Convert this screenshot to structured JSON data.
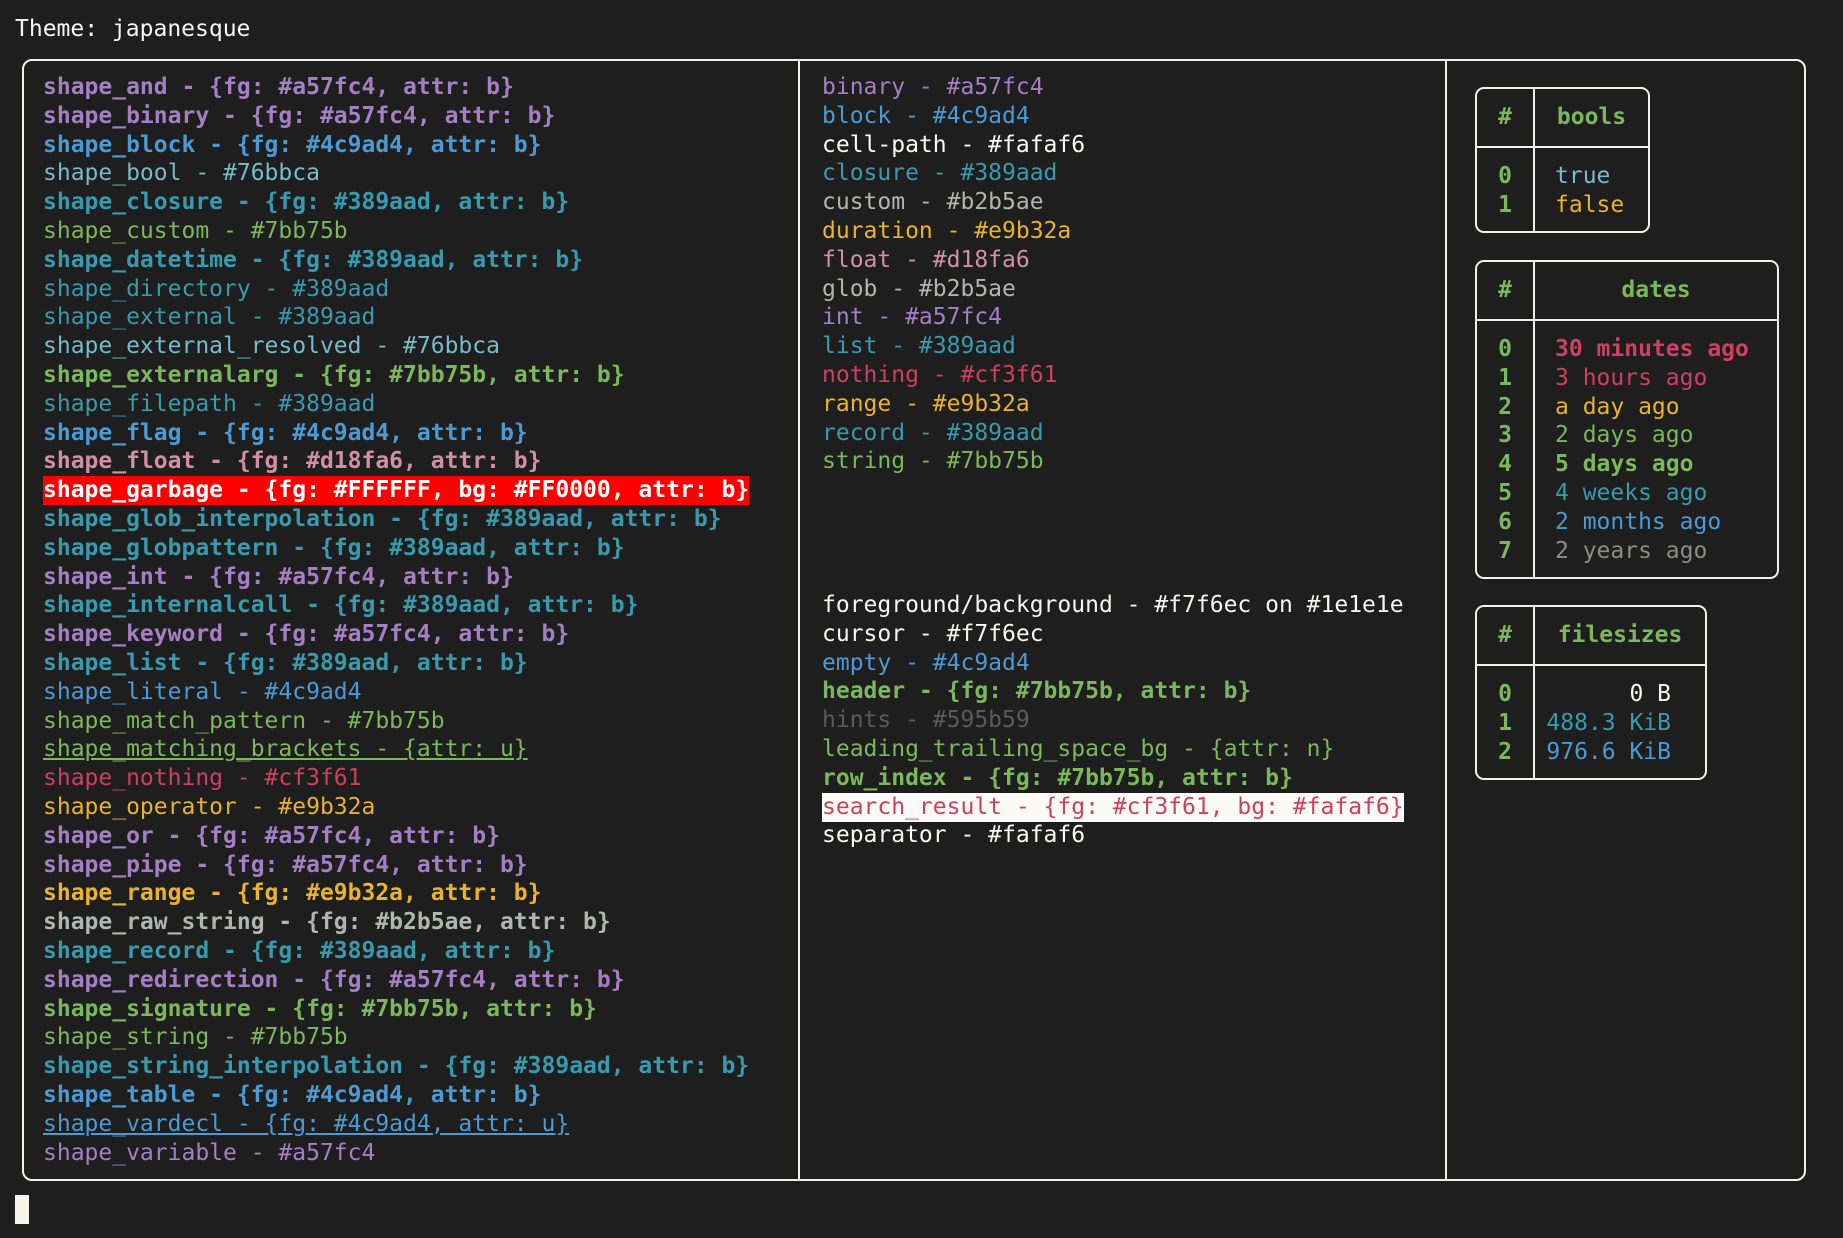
{
  "title": "Theme: japanesque",
  "left_column": [
    {
      "text": "shape_and - {fg: #a57fc4, attr: b}",
      "fg": "#a57fc4",
      "bold": true
    },
    {
      "text": "shape_binary - {fg: #a57fc4, attr: b}",
      "fg": "#a57fc4",
      "bold": true
    },
    {
      "text": "shape_block - {fg: #4c9ad4, attr: b}",
      "fg": "#4c9ad4",
      "bold": true
    },
    {
      "text": "shape_bool - #76bbca",
      "fg": "#76bbca"
    },
    {
      "text": "shape_closure - {fg: #389aad, attr: b}",
      "fg": "#389aad",
      "bold": true
    },
    {
      "text": "shape_custom - #7bb75b",
      "fg": "#7bb75b"
    },
    {
      "text": "shape_datetime - {fg: #389aad, attr: b}",
      "fg": "#389aad",
      "bold": true
    },
    {
      "text": "shape_directory - #389aad",
      "fg": "#389aad"
    },
    {
      "text": "shape_external - #389aad",
      "fg": "#389aad"
    },
    {
      "text": "shape_external_resolved - #76bbca",
      "fg": "#76bbca"
    },
    {
      "text": "shape_externalarg - {fg: #7bb75b, attr: b}",
      "fg": "#7bb75b",
      "bold": true
    },
    {
      "text": "shape_filepath - #389aad",
      "fg": "#389aad"
    },
    {
      "text": "shape_flag - {fg: #4c9ad4, attr: b}",
      "fg": "#4c9ad4",
      "bold": true
    },
    {
      "text": "shape_float - {fg: #d18fa6, attr: b}",
      "fg": "#d18fa6",
      "bold": true
    },
    {
      "text": "shape_garbage - {fg: #FFFFFF, bg: #FF0000, attr: b}",
      "fg": "#FFFFFF",
      "bg": "#FF0000",
      "bold": true
    },
    {
      "text": "shape_glob_interpolation - {fg: #389aad, attr: b}",
      "fg": "#389aad",
      "bold": true
    },
    {
      "text": "shape_globpattern - {fg: #389aad, attr: b}",
      "fg": "#389aad",
      "bold": true
    },
    {
      "text": "shape_int - {fg: #a57fc4, attr: b}",
      "fg": "#a57fc4",
      "bold": true
    },
    {
      "text": "shape_internalcall - {fg: #389aad, attr: b}",
      "fg": "#389aad",
      "bold": true
    },
    {
      "text": "shape_keyword - {fg: #a57fc4, attr: b}",
      "fg": "#a57fc4",
      "bold": true
    },
    {
      "text": "shape_list - {fg: #389aad, attr: b}",
      "fg": "#389aad",
      "bold": true
    },
    {
      "text": "shape_literal - #4c9ad4",
      "fg": "#4c9ad4"
    },
    {
      "text": "shape_match_pattern - #7bb75b",
      "fg": "#7bb75b"
    },
    {
      "text": "shape_matching_brackets - {attr: u}",
      "fg": "#7bb75b",
      "underline": true
    },
    {
      "text": "shape_nothing - #cf3f61",
      "fg": "#cf3f61"
    },
    {
      "text": "shape_operator - #e9b32a",
      "fg": "#e9b32a"
    },
    {
      "text": "shape_or - {fg: #a57fc4, attr: b}",
      "fg": "#a57fc4",
      "bold": true
    },
    {
      "text": "shape_pipe - {fg: #a57fc4, attr: b}",
      "fg": "#a57fc4",
      "bold": true
    },
    {
      "text": "shape_range - {fg: #e9b32a, attr: b}",
      "fg": "#e9b32a",
      "bold": true
    },
    {
      "text": "shape_raw_string - {fg: #b2b5ae, attr: b}",
      "fg": "#b2b5ae",
      "bold": true
    },
    {
      "text": "shape_record - {fg: #389aad, attr: b}",
      "fg": "#389aad",
      "bold": true
    },
    {
      "text": "shape_redirection - {fg: #a57fc4, attr: b}",
      "fg": "#a57fc4",
      "bold": true
    },
    {
      "text": "shape_signature - {fg: #7bb75b, attr: b}",
      "fg": "#7bb75b",
      "bold": true
    },
    {
      "text": "shape_string - #7bb75b",
      "fg": "#7bb75b"
    },
    {
      "text": "shape_string_interpolation - {fg: #389aad, attr: b}",
      "fg": "#389aad",
      "bold": true
    },
    {
      "text": "shape_table - {fg: #4c9ad4, attr: b}",
      "fg": "#4c9ad4",
      "bold": true
    },
    {
      "text": "shape_vardecl - {fg: #4c9ad4, attr: u}",
      "fg": "#4c9ad4",
      "underline": true
    },
    {
      "text": "shape_variable - #a57fc4",
      "fg": "#a57fc4"
    }
  ],
  "middle_column_types": [
    {
      "text": "binary - #a57fc4",
      "fg": "#a57fc4"
    },
    {
      "text": "block - #4c9ad4",
      "fg": "#4c9ad4"
    },
    {
      "text": "cell-path - #fafaf6",
      "fg": "#fafaf6"
    },
    {
      "text": "closure - #389aad",
      "fg": "#389aad"
    },
    {
      "text": "custom - #b2b5ae",
      "fg": "#b2b5ae"
    },
    {
      "text": "duration - #e9b32a",
      "fg": "#e9b32a"
    },
    {
      "text": "float - #d18fa6",
      "fg": "#d18fa6"
    },
    {
      "text": "glob - #b2b5ae",
      "fg": "#b2b5ae"
    },
    {
      "text": "int - #a57fc4",
      "fg": "#a57fc4"
    },
    {
      "text": "list - #389aad",
      "fg": "#389aad"
    },
    {
      "text": "nothing - #cf3f61",
      "fg": "#cf3f61"
    },
    {
      "text": "range - #e9b32a",
      "fg": "#e9b32a"
    },
    {
      "text": "record - #389aad",
      "fg": "#389aad"
    },
    {
      "text": "string - #7bb75b",
      "fg": "#7bb75b"
    }
  ],
  "middle_column_ui": [
    {
      "text": "foreground/background - #f7f6ec on #1e1e1e",
      "fg": "#f7f6ec"
    },
    {
      "text": "cursor - #f7f6ec",
      "fg": "#f7f6ec"
    },
    {
      "text": "empty - #4c9ad4",
      "fg": "#4c9ad4"
    },
    {
      "text": "header - {fg: #7bb75b, attr: b}",
      "fg": "#7bb75b",
      "bold": true
    },
    {
      "text": "hints - #595b59",
      "fg": "#595b59"
    },
    {
      "text": "leading_trailing_space_bg - {attr: n}",
      "fg": "#7bb75b"
    },
    {
      "text": "row_index - {fg: #7bb75b, attr: b}",
      "fg": "#7bb75b",
      "bold": true
    },
    {
      "text": "search_result - {fg: #cf3f61, bg: #fafaf6}",
      "fg": "#cf3f61",
      "bg": "#fafaf6"
    },
    {
      "text": "separator - #fafaf6",
      "fg": "#fafaf6"
    }
  ],
  "tables": {
    "bools": {
      "index_header": "#",
      "header": "bools",
      "rows": [
        {
          "index": "0",
          "value": "true",
          "fg": "#76bbca"
        },
        {
          "index": "1",
          "value": "false",
          "fg": "#e9b32a"
        }
      ]
    },
    "dates": {
      "index_header": "#",
      "header": "dates",
      "rows": [
        {
          "index": "0",
          "value": "30 minutes ago",
          "fg": "#cf3f61",
          "bold": true
        },
        {
          "index": "1",
          "value": "3 hours ago",
          "fg": "#cf3f61"
        },
        {
          "index": "2",
          "value": "a day ago",
          "fg": "#e9b32a"
        },
        {
          "index": "3",
          "value": "2 days ago",
          "fg": "#7bb75b"
        },
        {
          "index": "4",
          "value": "5 days ago",
          "fg": "#7bb75b",
          "bold": true
        },
        {
          "index": "5",
          "value": "4 weeks ago",
          "fg": "#389aad"
        },
        {
          "index": "6",
          "value": "2 months ago",
          "fg": "#4c9ad4"
        },
        {
          "index": "7",
          "value": "2 years ago",
          "fg": "#8a8c88"
        }
      ]
    },
    "filesizes": {
      "index_header": "#",
      "header": "filesizes",
      "rows": [
        {
          "index": "0",
          "value": "0 B",
          "fg": "#f7f6ec"
        },
        {
          "index": "1",
          "value": "488.3 KiB",
          "fg": "#389aad"
        },
        {
          "index": "2",
          "value": "976.6 KiB",
          "fg": "#4c9ad4"
        }
      ]
    }
  },
  "colors": {
    "background": "#1e1e1e",
    "foreground": "#f7f6ec",
    "border": "#f0f0ea",
    "index": "#7bb75b"
  }
}
